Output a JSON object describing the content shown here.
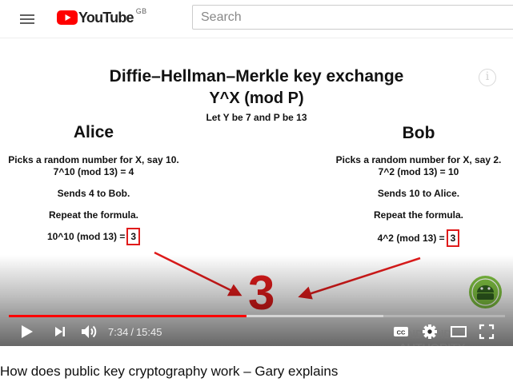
{
  "header": {
    "logo_text": "YouTube",
    "region": "GB",
    "search_placeholder": "Search"
  },
  "colors": {
    "brand_red": "#ff0000",
    "slide_red": "#e01b1b",
    "logo_badge_green": "#7fc241"
  },
  "slide": {
    "title": "Diffie–Hellman–Merkle key exchange",
    "formula": "Y^X (mod P)",
    "note": "Let Y be 7 and P be 13",
    "alice": {
      "name": "Alice",
      "lines": [
        "Picks a random number for X, say 10.",
        "7^10 (mod 13) = 4",
        "Sends 4 to Bob.",
        "Repeat the formula.",
        "10^10 (mod 13) ="
      ],
      "result": "3"
    },
    "bob": {
      "name": "Bob",
      "lines": [
        "Picks a random number for X, say 2.",
        "7^2 (mod 13) = 10",
        "Sends 10 to Alice.",
        "Repeat the formula.",
        "4^2 (mod 13) ="
      ],
      "result": "3"
    },
    "shared_secret": "3",
    "watermark": "ANDROID AUTHORITY"
  },
  "player": {
    "current_time": "7:34",
    "separator": "/",
    "duration": "15:45",
    "played_fraction": 0.479,
    "loaded_fraction": 0.755,
    "icons": [
      "play-icon",
      "next-icon",
      "volume-icon",
      "captions-icon",
      "settings-icon",
      "theater-icon",
      "fullscreen-icon"
    ]
  },
  "video": {
    "title": "How does public key cryptography work – Gary explains"
  }
}
